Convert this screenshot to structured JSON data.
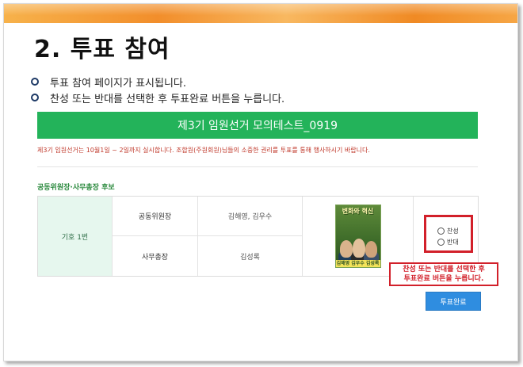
{
  "slide": {
    "title": "2. 투표 참여",
    "bullets": [
      "투표 참여 페이지가 표시됩니다.",
      "찬성 또는 반대를 선택한 후 투표완료 버튼을 누릅니다."
    ]
  },
  "vote": {
    "header": "제3기 임원선거 모의테스트_0919",
    "notice": "제3기 임원선거는 10월1일 ~ 2일까지 실시합니다. 조합원(주원회원)님들의 소중한 권리를 투표를 통해 행사하시기 바랍니다.",
    "section_label": "공동위원장·사무총장 후보",
    "candidate_number": "기호 1번",
    "rows": [
      {
        "position": "공동위원장",
        "names": "김해영, 김우수"
      },
      {
        "position": "사무총장",
        "names": "김성록"
      }
    ],
    "poster": {
      "headline": "변화와 혁신",
      "footer": "김해영 김우수 김성록"
    },
    "options": {
      "approve": "찬성",
      "reject": "반대"
    },
    "complete_button": "투표완료"
  },
  "callout": {
    "line1": "찬성 또는 반대를 선택한 후",
    "line2": "투표완료 버튼을 누릅니다."
  },
  "colors": {
    "accent_green": "#23b35a",
    "highlight_red": "#d2202a",
    "button_blue": "#2f8de0"
  }
}
